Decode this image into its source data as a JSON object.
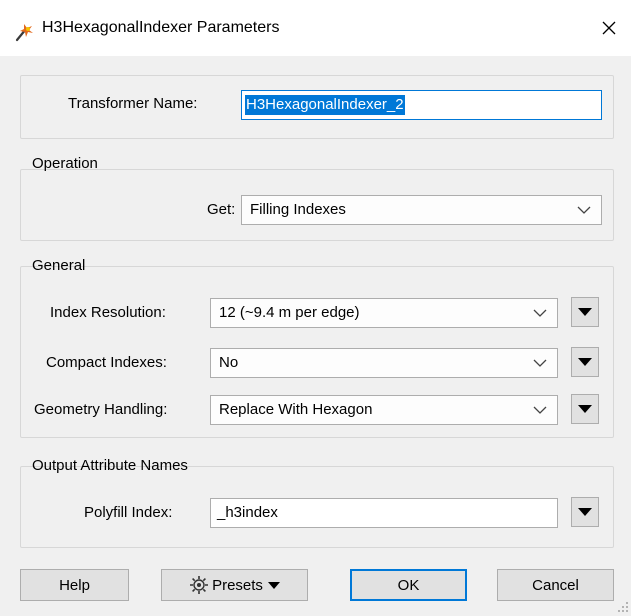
{
  "window": {
    "title": "H3HexagonalIndexer Parameters",
    "app_icon": "fme-transformer-icon",
    "close_icon": "close-icon"
  },
  "transformer": {
    "label": "Transformer Name:",
    "value": "H3HexagonalIndexer_2"
  },
  "operation": {
    "title": "Operation",
    "get_label": "Get:",
    "get_value": "Filling Indexes"
  },
  "general": {
    "title": "General",
    "index_resolution_label": "Index Resolution:",
    "index_resolution_value": "12 (~9.4 m per edge)",
    "compact_label": "Compact Indexes:",
    "compact_value": "No",
    "geometry_label": "Geometry Handling:",
    "geometry_value": "Replace With Hexagon"
  },
  "output": {
    "title": "Output Attribute Names",
    "polyfill_label": "Polyfill Index:",
    "polyfill_value": "_h3index"
  },
  "buttons": {
    "help": "Help",
    "presets": "Presets",
    "ok": "OK",
    "cancel": "Cancel"
  },
  "colors": {
    "accent": "#0078d7",
    "dialog_bg": "#f0f0f0",
    "button_bg": "#e1e1e1"
  }
}
